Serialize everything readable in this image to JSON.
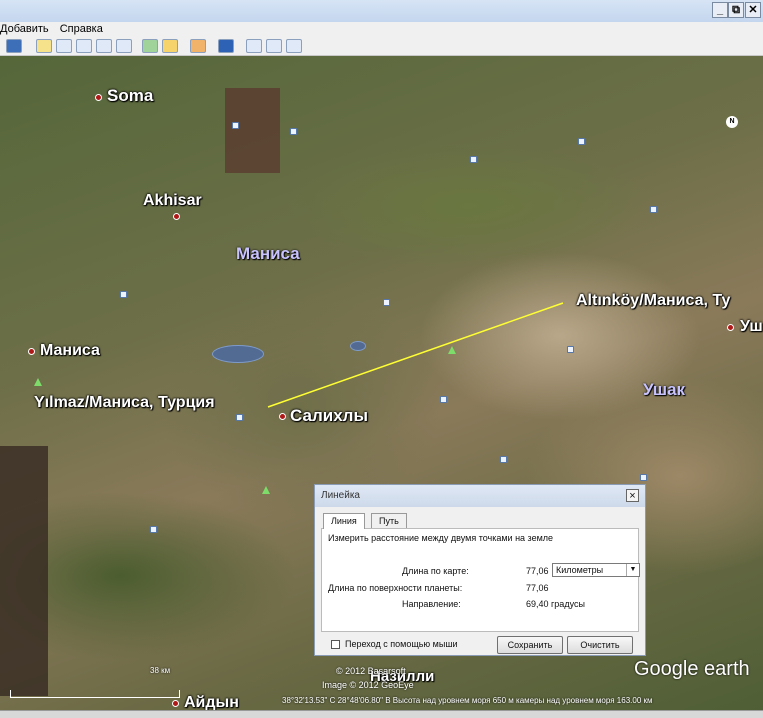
{
  "menu": {
    "add": "Добавить",
    "help": "Справка"
  },
  "window_controls": {
    "minimize": "_",
    "restore": "⧉",
    "close": "✕"
  },
  "map": {
    "places": {
      "soma": "Soma",
      "akhisar": "Akhisar",
      "manisa_province": "Маниса",
      "manisa_city": "Маниса",
      "salihli": "Салихлы",
      "usak": "Ушак",
      "usak_city": "Уш",
      "aydin": "Айдын",
      "nazilli": "Назилли"
    },
    "points": {
      "start": "Yılmaz/Маниса, Турция",
      "end": "Altınköy/Маниса, Ту"
    },
    "compass": "N",
    "scale_label": "38 км",
    "attribution": [
      "© 2012 Basarsoft",
      "Image © 2012 GeoEye"
    ],
    "logo": "Google earth",
    "status_text": "38°32'13.53\" С  28°48'06.80\" В Высота над уровнем моря  650 м камеры над уровнем моря  163.00 км"
  },
  "ruler": {
    "title": "Линейка",
    "close": "×",
    "tabs": [
      "Линия",
      "Путь"
    ],
    "description": "Измерить расстояние между двумя точками на земле",
    "map_length_label": "Длина по карте:",
    "map_length_value": "77,06",
    "unit": "Километры",
    "ground_length_label": "Длина по поверхности планеты:",
    "ground_length_value": "77,06",
    "heading_label": "Направление:",
    "heading_value": "69,40 градусы",
    "mouse_nav_label": "Переход с помощью мыши",
    "save_label": "Сохранить",
    "clear_label": "Очистить"
  }
}
